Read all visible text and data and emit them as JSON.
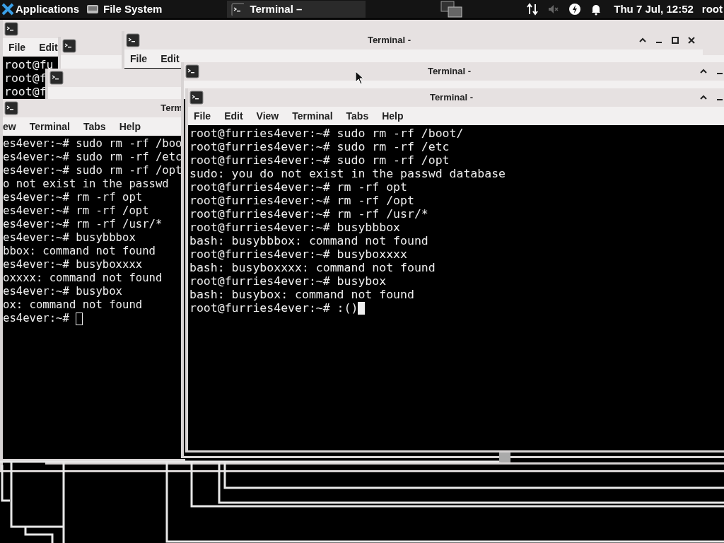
{
  "panel": {
    "apps_label": "Applications",
    "places_label": "File System",
    "tasks": [
      {
        "label": "Terminal –",
        "selected": true
      }
    ],
    "clock": "Thu 7 Jul, 12:52",
    "user": "root"
  },
  "windows": [
    {
      "kind": "terminal",
      "menu": [
        "File",
        "Edit"
      ],
      "lines": [
        "root@fu",
        "root@f",
        "root@f"
      ]
    },
    {
      "kind": "stub"
    },
    {
      "kind": "terminal",
      "title": "Terminal -",
      "menu": [
        "File",
        "Edit"
      ]
    },
    {
      "kind": "stub"
    },
    {
      "kind": "terminal",
      "title": "Term",
      "menu": [
        "ew",
        "Terminal",
        "Tabs",
        "Help"
      ],
      "focused": false,
      "lines": [
        "es4ever:~# sudo rm -rf /boo",
        "es4ever:~# sudo rm -rf /etc",
        "es4ever:~# sudo rm -rf /opt",
        "o not exist in the passwd",
        "es4ever:~# rm -rf opt",
        "es4ever:~# rm -rf /opt",
        "es4ever:~# rm -rf /usr/*",
        "es4ever:~# busybbbox",
        "bbox: command not found",
        "es4ever:~# busyboxxxx",
        "oxxxx: command not found",
        "es4ever:~# busybox",
        "ox: command not found",
        "es4ever:~# "
      ]
    },
    {
      "kind": "terminal",
      "title": "Terminal -"
    },
    {
      "kind": "terminal",
      "title": "Terminal -",
      "menu": [
        "File",
        "Edit",
        "View",
        "Terminal",
        "Tabs",
        "Help"
      ],
      "focused": true,
      "lines": [
        "root@furries4ever:~# sudo rm -rf /boot/",
        "root@furries4ever:~# sudo rm -rf /etc",
        "root@furries4ever:~# sudo rm -rf /opt",
        "sudo: you do not exist in the passwd database",
        "root@furries4ever:~# rm -rf opt",
        "root@furries4ever:~# rm -rf /opt",
        "root@furries4ever:~# rm -rf /usr/*",
        "root@furries4ever:~# busybbbox",
        "bash: busybbbox: command not found",
        "root@furries4ever:~# busyboxxxx",
        "bash: busyboxxxx: command not found",
        "root@furries4ever:~# busybox",
        "bash: busybox: command not found",
        "root@furries4ever:~# :()"
      ]
    }
  ]
}
